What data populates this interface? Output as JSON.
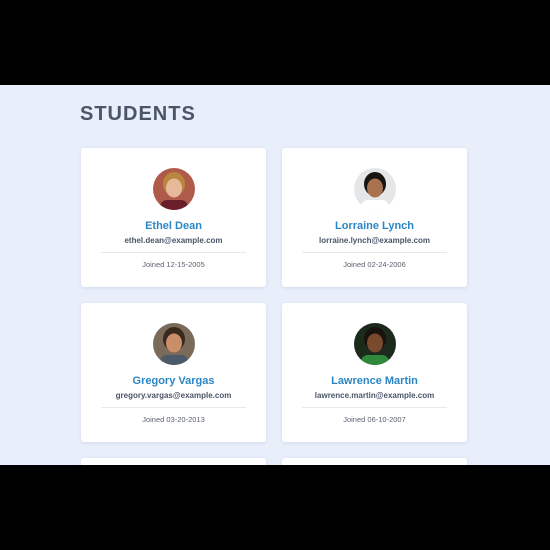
{
  "page": {
    "title": "STUDENTS"
  },
  "students": [
    {
      "name": "Ethel Dean",
      "email": "ethel.dean@example.com",
      "joined": "Joined 12-15-2005",
      "avatar_bg": "#b05a4a",
      "skin": "#e8b89a",
      "hair": "#b8863c",
      "shirt": "#6a1e2a"
    },
    {
      "name": "Lorraine Lynch",
      "email": "lorraine.lynch@example.com",
      "joined": "Joined 02-24-2006",
      "avatar_bg": "#e4e6e8",
      "skin": "#a8724f",
      "hair": "#1a1410",
      "shirt": "#ffffff"
    },
    {
      "name": "Gregory Vargas",
      "email": "gregory.vargas@example.com",
      "joined": "Joined 03-20-2013",
      "avatar_bg": "#7a6a5a",
      "skin": "#c98f6b",
      "hair": "#3a2a1e",
      "shirt": "#4a5a6a"
    },
    {
      "name": "Lawrence Martin",
      "email": "lawrence.martin@example.com",
      "joined": "Joined 06-10-2007",
      "avatar_bg": "#1c2a1c",
      "skin": "#7a4a2e",
      "hair": "#1a120c",
      "shirt": "#2e8a3a"
    }
  ]
}
